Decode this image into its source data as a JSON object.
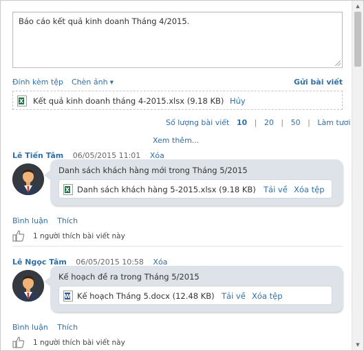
{
  "composer": {
    "text": "Báo cáo kết quả kinh doanh Tháng 4/2015.",
    "attach_file": "Đính kèm tệp",
    "insert_image": "Chèn ảnh",
    "submit": "Gửi bài viết",
    "attachment": {
      "name": "Kết quả kinh doanh tháng 4-2015.xlsx (9.18 KB)",
      "cancel": "Hủy",
      "icon": "excel-file-icon"
    }
  },
  "paging": {
    "label": "Số lượng bài viết",
    "options": [
      "10",
      "20",
      "50"
    ],
    "selected": "10",
    "refresh": "Làm tươi",
    "separator": "|"
  },
  "see_more": "Xem thêm...",
  "posts": [
    {
      "author": "Lê Tiến Tâm",
      "date": "06/05/2015 11:01",
      "delete": "Xóa",
      "text": "Danh sách khách hàng mới trong Tháng 5/2015",
      "file": {
        "name": "Danh sách khách hàng 5-2015.xlsx (9.18 KB)",
        "download": "Tải về",
        "remove": "Xóa tệp",
        "icon": "excel-file-icon"
      },
      "comment": "Bình luận",
      "like": "Thích",
      "likes_text": "1 người thích bài viết này"
    },
    {
      "author": "Lê Ngọc Tâm",
      "date": "06/05/2015 10:58",
      "delete": "Xóa",
      "text": "Kế hoạch đề ra trong Tháng 5/2015",
      "file": {
        "name": "Kế hoạch Tháng 5.docx (12.48 KB)",
        "download": "Tải về",
        "remove": "Xóa tệp",
        "icon": "word-file-icon"
      },
      "comment": "Bình luận",
      "like": "Thích",
      "likes_text": "1 người thích bài viết này"
    }
  ],
  "colors": {
    "link": "#2f6fa7",
    "bubble": "#dde3e8",
    "excel": "#1e7145",
    "word": "#2b579a"
  }
}
